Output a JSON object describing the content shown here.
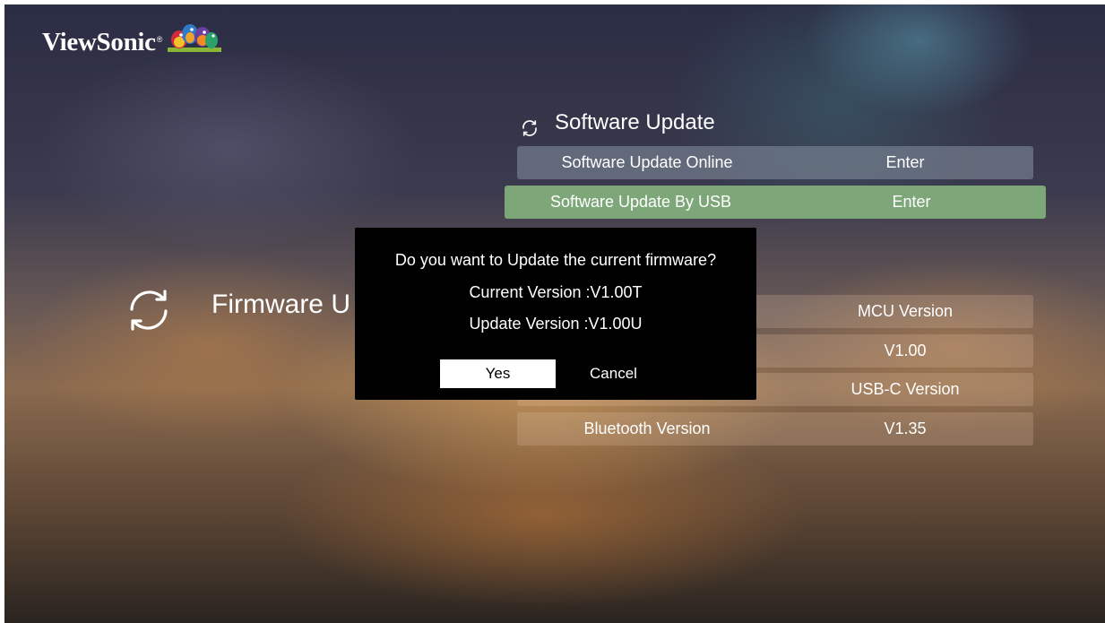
{
  "brand": {
    "name": "ViewSonic",
    "trademark": "®"
  },
  "left_panel": {
    "title": "Firmware U",
    "icon": "refresh-icon"
  },
  "section": {
    "title": "Software Update",
    "icon": "refresh-icon"
  },
  "menu": [
    {
      "label": "Software Update Online",
      "value": "Enter",
      "state": "normal"
    },
    {
      "label": "Software Update By USB",
      "value": "Enter",
      "state": "selected"
    }
  ],
  "info_rows": [
    {
      "label": "",
      "value": "MCU Version"
    },
    {
      "label": "",
      "value": "V1.00"
    },
    {
      "label": "",
      "value": "USB-C Version"
    },
    {
      "label": "Bluetooth Version",
      "value": "V1.35"
    }
  ],
  "dialog": {
    "question": "Do you want to Update the current firmware?",
    "current_version": "Current Version :V1.00T",
    "update_version": "Update Version :V1.00U",
    "yes_label": "Yes",
    "cancel_label": "Cancel"
  },
  "colors": {
    "selected_row": "#7ea779",
    "dialog_bg": "#000000"
  }
}
